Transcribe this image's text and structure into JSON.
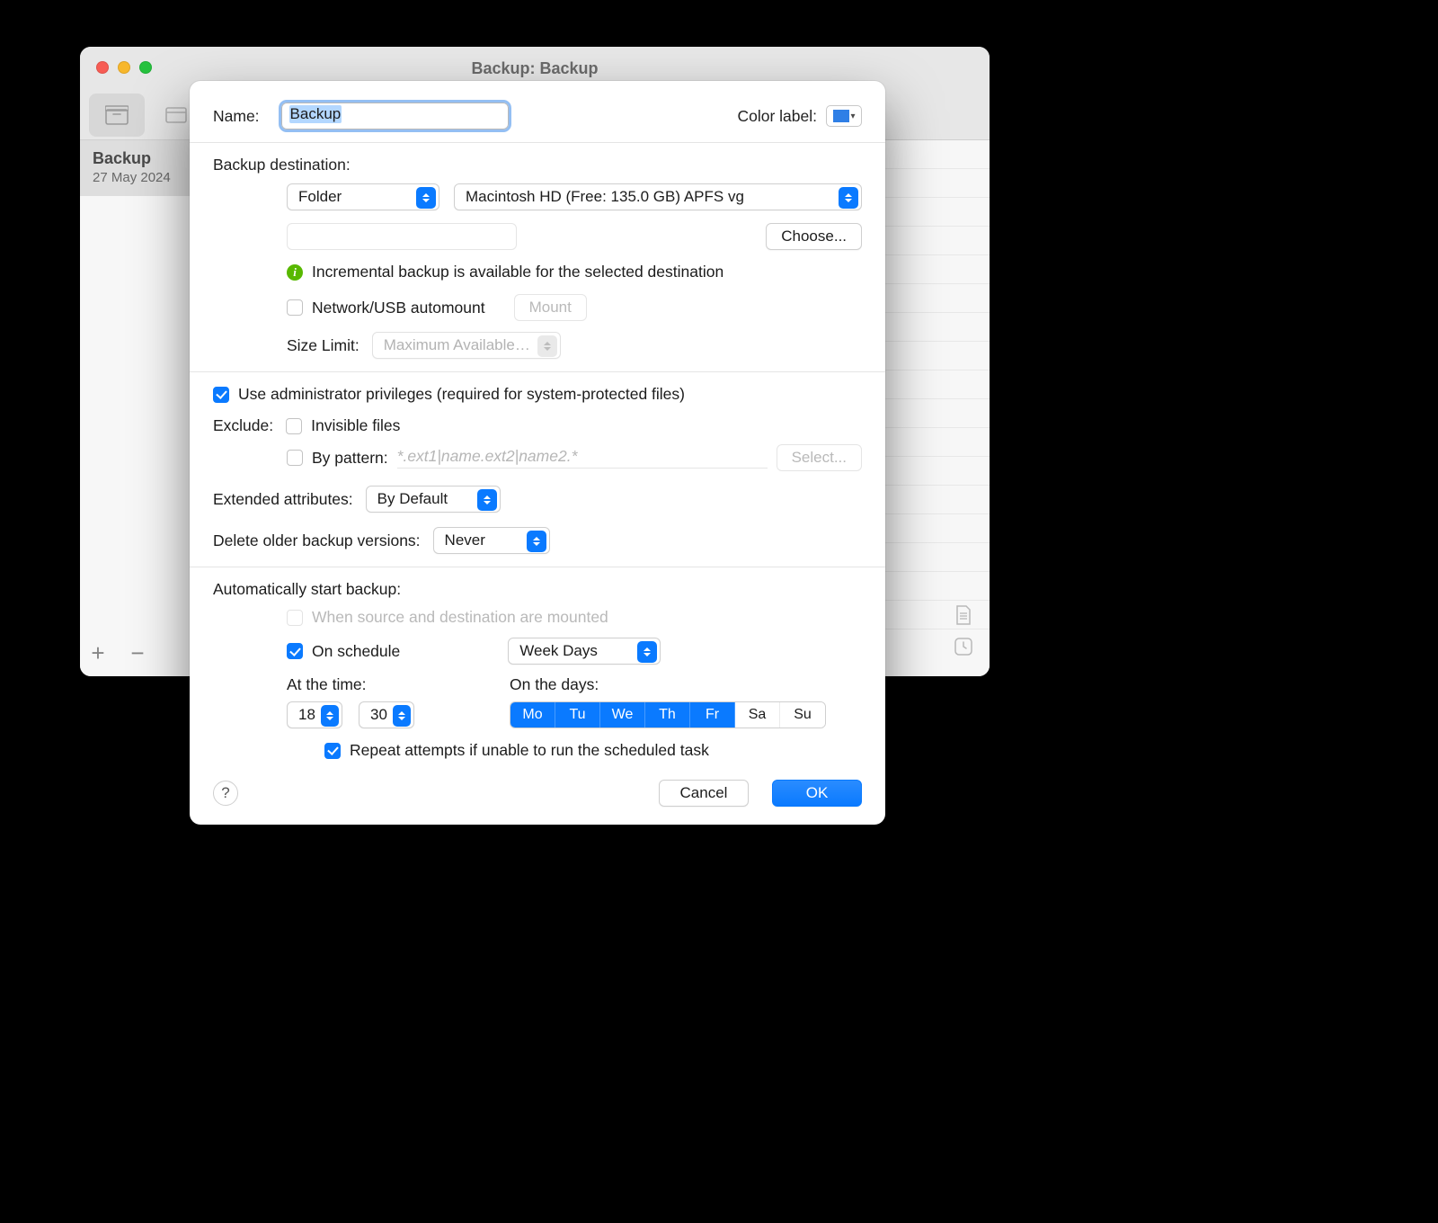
{
  "bg_window": {
    "title": "Backup: Backup",
    "sidebar_item": {
      "title": "Backup",
      "date": "27 May 2024"
    },
    "footer_plus": "+",
    "footer_minus": "−"
  },
  "sheet": {
    "name_label": "Name:",
    "name_value": "Backup",
    "color_label": "Color label:",
    "color_value": "#2f7fe6",
    "destination_heading": "Backup destination:",
    "destination_type": "Folder",
    "destination_volume": "Macintosh HD (Free: 135.0 GB) APFS vg",
    "choose_label": "Choose...",
    "incremental_note": "Incremental backup is available for the selected destination",
    "automount_label": "Network/USB automount",
    "automount_checked": false,
    "mount_label": "Mount",
    "size_limit_label": "Size Limit:",
    "size_limit_value": "Maximum Available…",
    "admin_label": "Use administrator privileges (required for system-protected files)",
    "admin_checked": true,
    "exclude_label": "Exclude:",
    "exclude_invisible_label": "Invisible files",
    "exclude_invisible_checked": false,
    "exclude_pattern_label": "By pattern:",
    "exclude_pattern_checked": false,
    "exclude_pattern_placeholder": "*.ext1|name.ext2|name2.*",
    "exclude_select_label": "Select...",
    "ext_attr_label": "Extended attributes:",
    "ext_attr_value": "By Default",
    "delete_older_label": "Delete older backup versions:",
    "delete_older_value": "Never",
    "auto_heading": "Automatically start backup:",
    "auto_when_mounted_label": "When source and destination are mounted",
    "auto_when_mounted_checked": false,
    "auto_when_mounted_enabled": false,
    "auto_schedule_label": "On schedule",
    "auto_schedule_checked": true,
    "schedule_type": "Week Days",
    "at_time_label": "At the time:",
    "on_days_label": "On the days:",
    "time_hour": "18",
    "time_minute": "30",
    "days": [
      {
        "abbr": "Mo",
        "on": true
      },
      {
        "abbr": "Tu",
        "on": true
      },
      {
        "abbr": "We",
        "on": true
      },
      {
        "abbr": "Th",
        "on": true
      },
      {
        "abbr": "Fr",
        "on": true
      },
      {
        "abbr": "Sa",
        "on": false
      },
      {
        "abbr": "Su",
        "on": false
      }
    ],
    "repeat_label": "Repeat attempts if unable to run the scheduled task",
    "repeat_checked": true,
    "help_label": "?",
    "cancel_label": "Cancel",
    "ok_label": "OK"
  }
}
